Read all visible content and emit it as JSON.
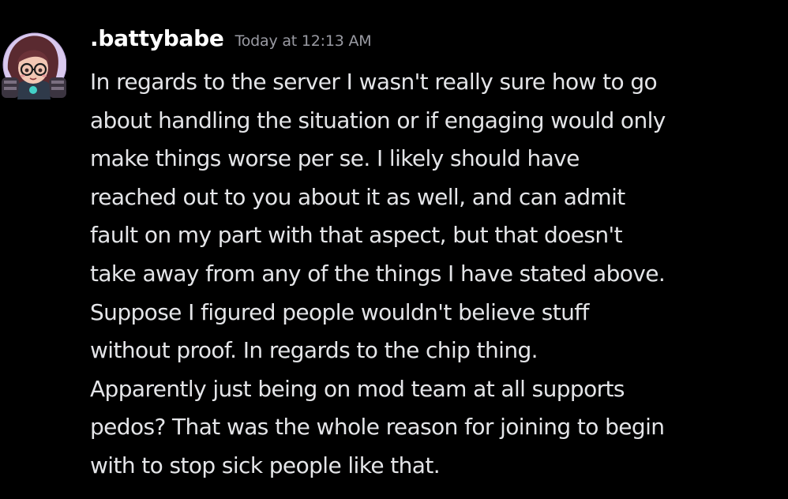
{
  "message": {
    "author": ".battybabe",
    "timestamp": "Today at 12:13 AM",
    "avatar_icon": "user-avatar-icon",
    "lines": [
      "In regards to the server I wasn't really sure how to go",
      "about handling the situation or if engaging would only",
      "make things worse per se. I likely should have",
      "reached out to you about it as well, and can admit",
      "fault on my part with that aspect, but that doesn't",
      "take away from any of the things I have stated above.",
      "Suppose I figured people wouldn't believe stuff",
      "without proof. In regards to the chip thing.",
      "Apparently just being on mod team at all supports",
      "pedos? That was the whole reason for joining to begin",
      "with to stop sick people like that."
    ]
  },
  "colors": {
    "background": "#000000",
    "username": "#ffffff",
    "timestamp": "#9a9ba3",
    "text": "#e4e5e8",
    "avatar_bg": "#d9c9ee"
  }
}
